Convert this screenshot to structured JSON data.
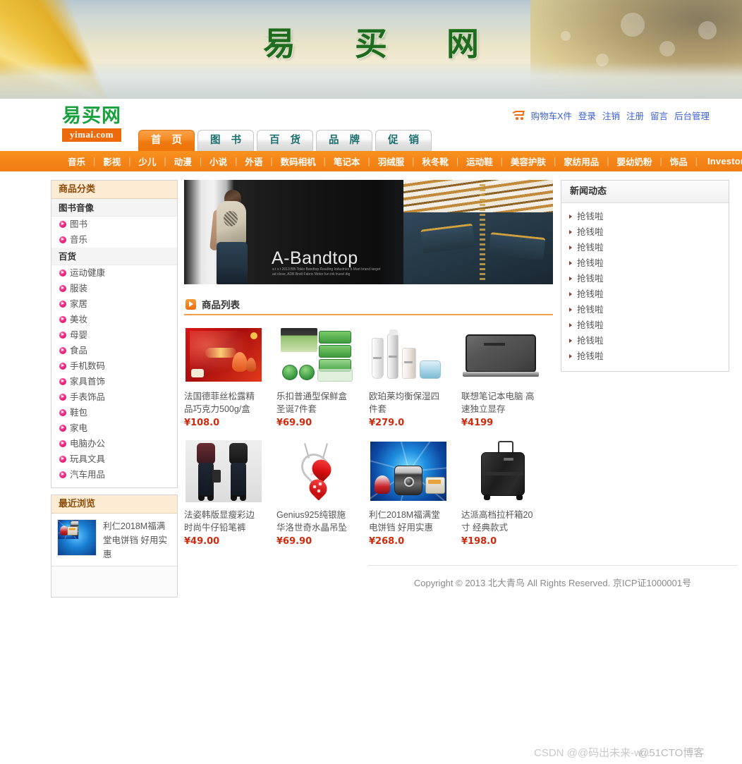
{
  "banner": {
    "title": "易 买 网"
  },
  "header": {
    "logo_zh": "易买网",
    "logo_en": "yimai.com",
    "utility": [
      {
        "label": "购物车X件"
      },
      {
        "label": "登录"
      },
      {
        "label": "注销"
      },
      {
        "label": "注册"
      },
      {
        "label": "留言"
      },
      {
        "label": "后台管理"
      }
    ],
    "tabs": [
      {
        "label": "首 页",
        "active": true
      },
      {
        "label": "图 书",
        "active": false
      },
      {
        "label": "百 货",
        "active": false
      },
      {
        "label": "品 牌",
        "active": false
      },
      {
        "label": "促 销",
        "active": false
      }
    ]
  },
  "subnav": [
    {
      "label": "音乐"
    },
    {
      "label": "影视"
    },
    {
      "label": "少儿"
    },
    {
      "label": "动漫"
    },
    {
      "label": "小说"
    },
    {
      "label": "外语"
    },
    {
      "label": "数码相机"
    },
    {
      "label": "笔记本"
    },
    {
      "label": "羽绒服"
    },
    {
      "label": "秋冬靴"
    },
    {
      "label": "运动鞋"
    },
    {
      "label": "美容护肤"
    },
    {
      "label": "家纺用品"
    },
    {
      "label": "婴幼奶粉"
    },
    {
      "label": "饰品"
    },
    {
      "label": "Investor Relations",
      "en": true
    }
  ],
  "sidebar": {
    "title": "商品分类",
    "groups": [
      {
        "name": "图书音像",
        "items": [
          {
            "label": "图书"
          },
          {
            "label": "音乐"
          }
        ]
      },
      {
        "name": "百货",
        "items": [
          {
            "label": "运动健康"
          },
          {
            "label": "服装"
          },
          {
            "label": "家居"
          },
          {
            "label": "美妆"
          },
          {
            "label": "母婴"
          },
          {
            "label": "食品"
          },
          {
            "label": "手机数码"
          },
          {
            "label": "家具首饰"
          },
          {
            "label": "手表饰品"
          },
          {
            "label": "鞋包"
          },
          {
            "label": "家电"
          },
          {
            "label": "电脑办公"
          },
          {
            "label": "玩具文具"
          },
          {
            "label": "汽车用品"
          }
        ]
      }
    ],
    "recent": {
      "title": "最近浏览",
      "item_name": "利仁2018M福满堂电饼铛 好用实惠"
    }
  },
  "hero": {
    "brand": "A-Bandtop",
    "caption": "a t s t  2013 BB-Tokio Bandtop Reading Industries b Mart brand target ad close, ADB Bndt Fabric Motor fun ink travel dig"
  },
  "product_section": {
    "title": "商品列表",
    "products": [
      {
        "name": "法国德菲丝松露精品巧克力500g/盒",
        "price": "¥108.0",
        "thumb": "chocolate-box"
      },
      {
        "name": "乐扣普通型保鲜盒圣诞7件套",
        "price": "¥69.90",
        "thumb": "food-containers"
      },
      {
        "name": "欧珀莱均衡保湿四件套",
        "price": "¥279.0",
        "thumb": "cosmetics-set"
      },
      {
        "name": "联想笔记本电脑 高速独立显存",
        "price": "¥4199",
        "thumb": "laptop"
      },
      {
        "name": "法姿韩版显瘦彩边时尚牛仔铅笔裤",
        "price": "¥49.00",
        "thumb": "jeans-models"
      },
      {
        "name": "Genius925纯银施华洛世奇水晶吊坠",
        "price": "¥69.90",
        "thumb": "heart-pendant"
      },
      {
        "name": "利仁2018M福满堂电饼铛 好用实惠",
        "price": "¥268.0",
        "thumb": "electric-cooker"
      },
      {
        "name": "达派高档拉杆箱20寸 经典款式",
        "price": "¥198.0",
        "thumb": "suitcase"
      }
    ]
  },
  "news": {
    "title": "新闻动态",
    "items": [
      {
        "label": "抢钱啦"
      },
      {
        "label": "抢钱啦"
      },
      {
        "label": "抢钱啦"
      },
      {
        "label": "抢钱啦"
      },
      {
        "label": "抢钱啦"
      },
      {
        "label": "抢钱啦"
      },
      {
        "label": "抢钱啦"
      },
      {
        "label": "抢钱啦"
      },
      {
        "label": "抢钱啦"
      },
      {
        "label": "抢钱啦"
      }
    ]
  },
  "footer": {
    "text": "Copyright © 2013 北大青鸟 All Rights Reserved. 京ICP证1000001号"
  },
  "watermarks": {
    "left": "CSDN @@码出未来-w...",
    "right": "@51CTO博客"
  },
  "colors": {
    "accent_orange": "#f5851a",
    "logo_green": "#18a03c",
    "price_red": "#cf2a0e",
    "link_blue": "#3b5fd0",
    "banner_green": "#1d6b1d"
  }
}
